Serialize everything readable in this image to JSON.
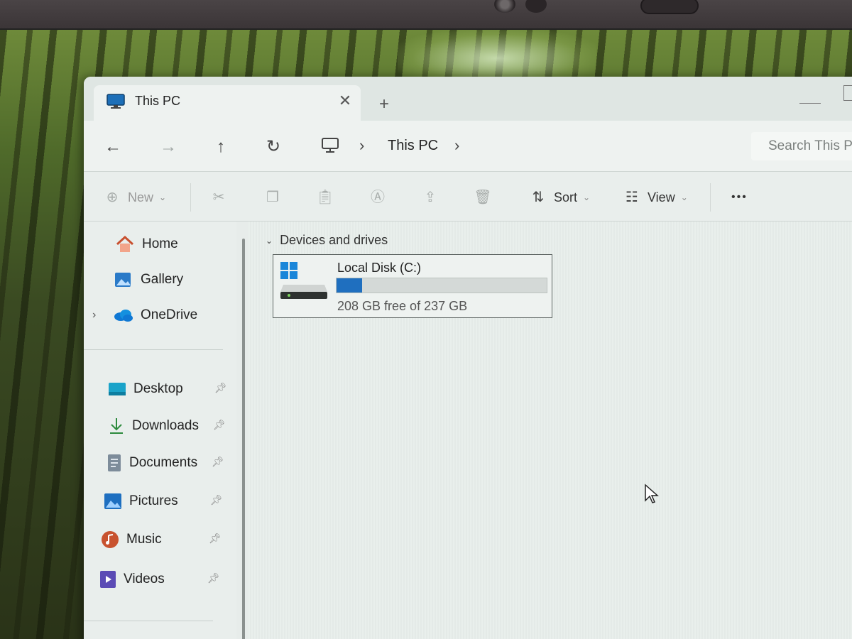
{
  "window": {
    "tab_title": "This PC",
    "tab_close": "✕",
    "new_tab": "+"
  },
  "navigation": {
    "back": "←",
    "forward": "→",
    "up": "↑",
    "refresh": "↻",
    "breadcrumb_sep": "›",
    "breadcrumb": [
      "This PC"
    ],
    "search_placeholder": "Search This P"
  },
  "toolbar": {
    "new_label": "New",
    "sort_label": "Sort",
    "view_label": "View",
    "more": "•••",
    "icons": [
      "cut-icon",
      "copy-icon",
      "paste-icon",
      "rename-icon",
      "share-icon",
      "delete-icon"
    ]
  },
  "sidebar": {
    "top_items": [
      {
        "label": "Home",
        "icon": "home-icon"
      },
      {
        "label": "Gallery",
        "icon": "gallery-icon"
      },
      {
        "label": "OneDrive",
        "icon": "onedrive-icon"
      }
    ],
    "quick_access": [
      {
        "label": "Desktop",
        "icon": "desktop-folder-icon"
      },
      {
        "label": "Downloads",
        "icon": "downloads-icon"
      },
      {
        "label": "Documents",
        "icon": "documents-icon"
      },
      {
        "label": "Pictures",
        "icon": "pictures-icon"
      },
      {
        "label": "Music",
        "icon": "music-icon"
      },
      {
        "label": "Videos",
        "icon": "videos-icon"
      }
    ]
  },
  "content": {
    "section_label": "Devices and drives",
    "drives": [
      {
        "name": "Local Disk (C:)",
        "space_text": "208 GB free of 237 GB",
        "used_fraction": 0.12
      }
    ]
  },
  "colors": {
    "accent": "#1f6fbf",
    "onedrive": "#0f78d4"
  }
}
